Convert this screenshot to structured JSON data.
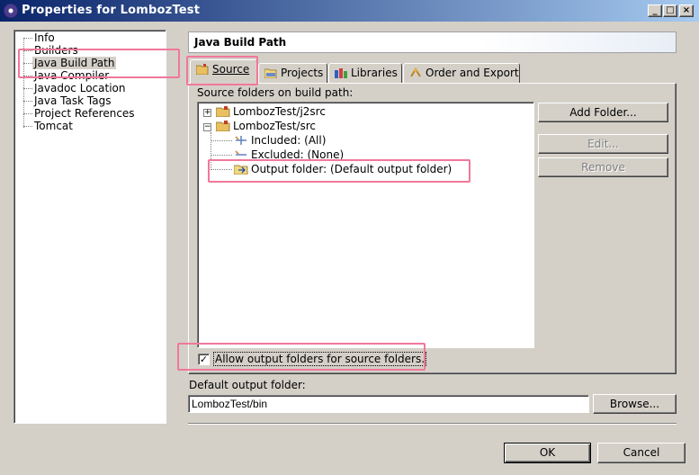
{
  "window": {
    "title": "Properties for LombozTest",
    "minimize": "_",
    "maximize": "□",
    "close": "×"
  },
  "nav": {
    "items": [
      {
        "label": "Info"
      },
      {
        "label": "Builders"
      },
      {
        "label": "Java Build Path",
        "selected": true
      },
      {
        "label": "Java Compiler"
      },
      {
        "label": "Javadoc Location"
      },
      {
        "label": "Java Task Tags"
      },
      {
        "label": "Project References"
      },
      {
        "label": "Tomcat"
      }
    ]
  },
  "page": {
    "heading": "Java Build Path"
  },
  "tabs": [
    {
      "label": "Source",
      "active": true,
      "icon": "source-folder-icon"
    },
    {
      "label": "Projects",
      "icon": "project-icon"
    },
    {
      "label": "Libraries",
      "icon": "library-icon"
    },
    {
      "label": "Order and Export",
      "icon": "order-export-icon"
    }
  ],
  "source": {
    "tree_label": "Source folders on build path:",
    "tree": [
      {
        "label": "LombozTest/j2src",
        "expanded": false
      },
      {
        "label": "LombozTest/src",
        "expanded": true
      },
      {
        "label": "Included: (All)"
      },
      {
        "label": "Excluded: (None)"
      },
      {
        "label": "Output folder: (Default output folder)"
      }
    ],
    "buttons": {
      "add_folder": "Add Folder...",
      "edit": "Edit...",
      "remove": "Remove"
    },
    "allow_output_checkbox": {
      "label": "Allow output folders for source folders.",
      "checked": true
    }
  },
  "default_output": {
    "label": "Default output folder:",
    "value": "LombozTest/bin",
    "browse": "Browse..."
  },
  "footer": {
    "ok": "OK",
    "cancel": "Cancel"
  },
  "colors": {
    "titlebar_start": "#0a246a",
    "titlebar_end": "#a6caf0",
    "highlight_box": "#f0789a",
    "dialog_bg": "#d4d0c8"
  }
}
